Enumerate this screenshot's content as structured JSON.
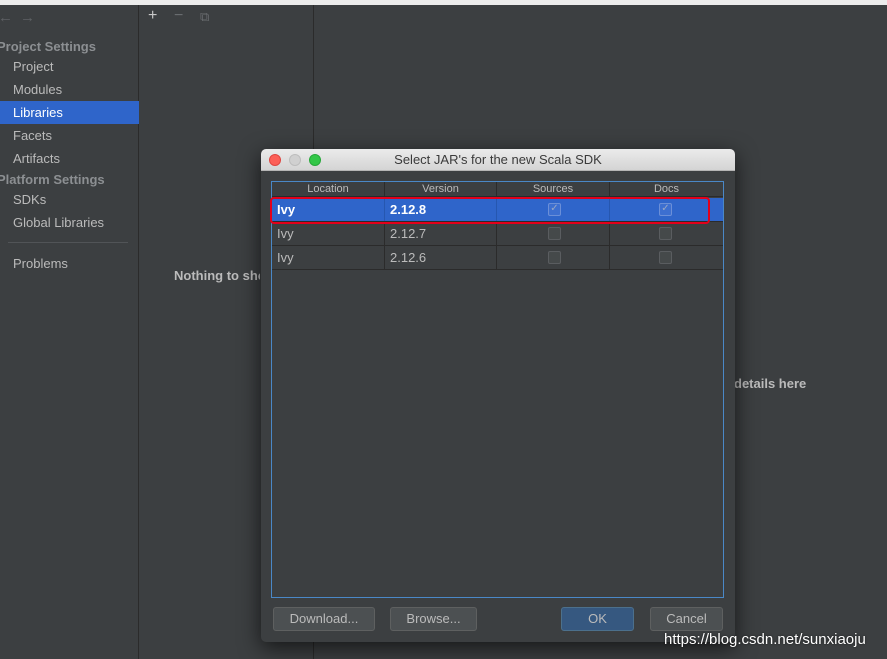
{
  "sidebar": {
    "project_settings_header": "Project Settings",
    "project_items": [
      {
        "label": "Project"
      },
      {
        "label": "Modules"
      },
      {
        "label": "Libraries"
      },
      {
        "label": "Facets"
      },
      {
        "label": "Artifacts"
      }
    ],
    "platform_settings_header": "Platform Settings",
    "platform_items": [
      {
        "label": "SDKs"
      },
      {
        "label": "Global Libraries"
      }
    ],
    "problems_label": "Problems",
    "back_glyph": "←",
    "forward_glyph": "→"
  },
  "libraries_panel": {
    "add_glyph": "+",
    "remove_glyph": "−",
    "copy_glyph": "⧉",
    "empty_text": "Nothing to show"
  },
  "details_panel": {
    "hint_text": "details here"
  },
  "dialog": {
    "title": "Select JAR's for the new Scala SDK",
    "columns": [
      "Location",
      "Version",
      "Sources",
      "Docs"
    ],
    "rows": [
      {
        "location": "Ivy",
        "version": "2.12.8",
        "sources": true,
        "docs": true,
        "selected": true
      },
      {
        "location": "Ivy",
        "version": "2.12.7",
        "sources": false,
        "docs": false,
        "selected": false
      },
      {
        "location": "Ivy",
        "version": "2.12.6",
        "sources": false,
        "docs": false,
        "selected": false
      }
    ],
    "buttons": {
      "download": "Download...",
      "browse": "Browse...",
      "ok": "OK",
      "cancel": "Cancel"
    }
  },
  "watermark": "https://blog.csdn.net/sunxiaoju",
  "colors": {
    "background": "#3c3f41",
    "selection": "#2f65ca",
    "highlight_box": "#e3001b",
    "ok_button": "#365880"
  }
}
